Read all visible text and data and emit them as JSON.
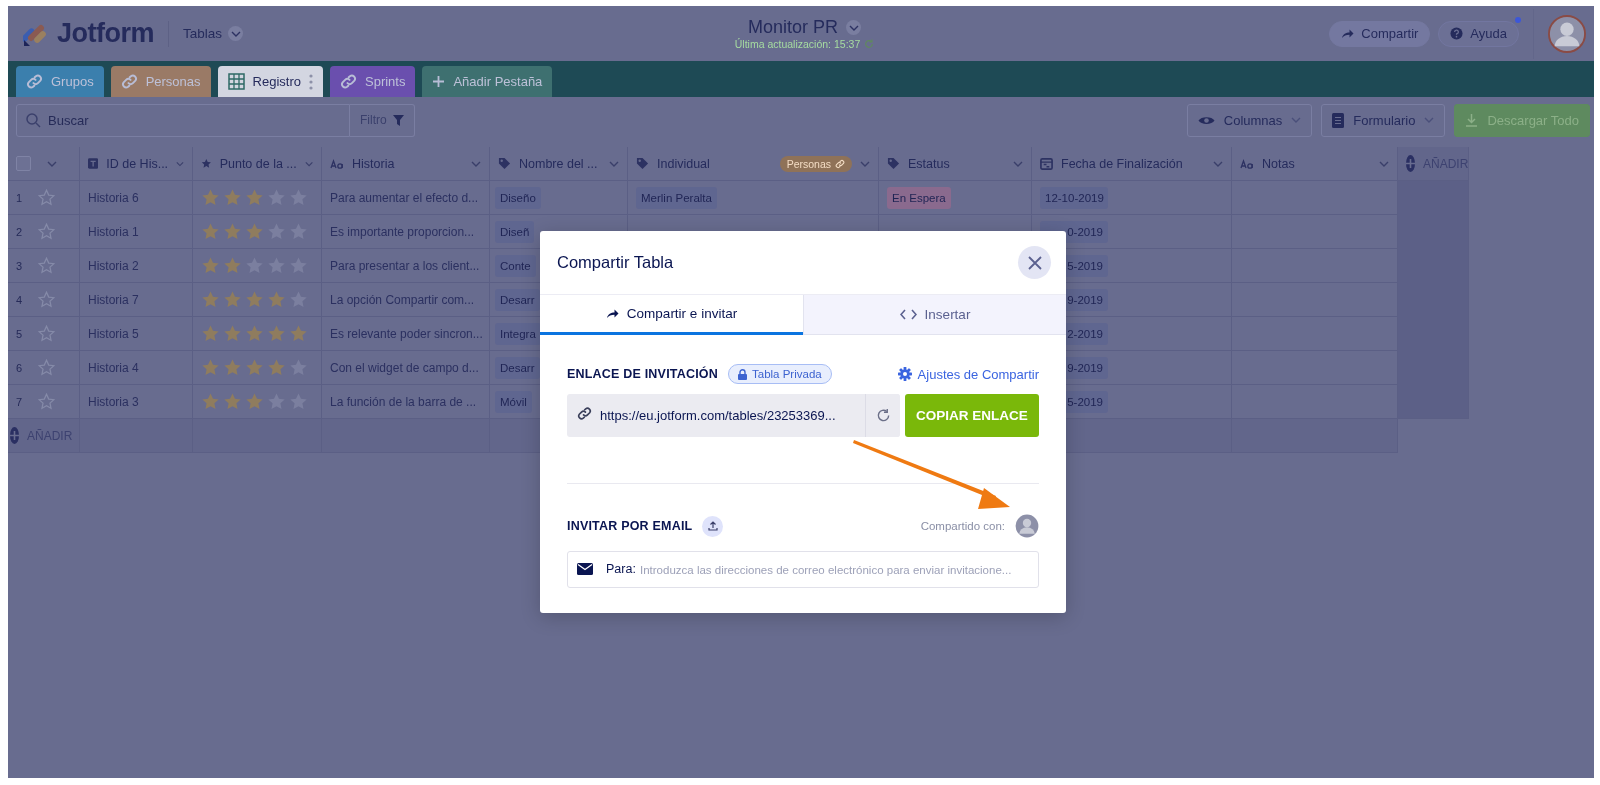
{
  "header": {
    "logo": "Jotform",
    "menu": "Tablas",
    "title": "Monitor PR",
    "subtitle": "Última actualización: 15:37",
    "share_button": "Compartir",
    "help_button": "Ayuda",
    "help_notification": true
  },
  "tabs": [
    {
      "label": "Grupos",
      "kind": "linked",
      "color": "#3b7fad",
      "selected": false
    },
    {
      "label": "Personas",
      "kind": "linked",
      "color": "#9a7a66",
      "selected": false
    },
    {
      "label": "Registro",
      "kind": "table",
      "color": "#d3d6e1",
      "selected": true
    },
    {
      "label": "Sprints",
      "kind": "linked",
      "color": "#6a4fae",
      "selected": false
    },
    {
      "label": "Añadir Pestaña",
      "kind": "add",
      "color": "#3e7070",
      "selected": false
    }
  ],
  "toolbar": {
    "search_placeholder": "Buscar",
    "filter": "Filtro",
    "columns_button": "Columnas",
    "form_button": "Formulario",
    "download_button": "Descargar Todo"
  },
  "table": {
    "select_all_checked": false,
    "columns": [
      {
        "label": "ID de His...",
        "kind": "id"
      },
      {
        "label": "Punto de la ...",
        "kind": "rating"
      },
      {
        "label": "Historia",
        "kind": "text"
      },
      {
        "label": "Nombre del ...",
        "kind": "tag"
      },
      {
        "label": "Individual",
        "kind": "tag",
        "badge": "Personas"
      },
      {
        "label": "Estatus",
        "kind": "tag"
      },
      {
        "label": "Fecha de Finalización",
        "kind": "date"
      },
      {
        "label": "Notas",
        "kind": "text"
      }
    ],
    "add_column": "AÑADIR",
    "rows": [
      {
        "number": "1",
        "favorite": false,
        "id": "Historia 6",
        "stars": 3,
        "story": "Para aumentar el efecto d...",
        "name": "Diseño",
        "individual": "Merlin Peralta",
        "status": {
          "text": "En Espera",
          "color": "#8a6a8e"
        },
        "date": "12-10-2019"
      },
      {
        "number": "2",
        "favorite": false,
        "id": "Historia 1",
        "stars": 3,
        "story": "Es importante proporcion...",
        "name": "Diseñ",
        "date": "0-2019"
      },
      {
        "number": "3",
        "favorite": false,
        "id": "Historia 2",
        "stars": 2,
        "story": "Para presentar a los client...",
        "name": "Conte",
        "date": "5-2019"
      },
      {
        "number": "4",
        "favorite": false,
        "id": "Historia 7",
        "stars": 4,
        "story": "La opción Compartir com...",
        "name": "Desarr",
        "date": "9-2019"
      },
      {
        "number": "5",
        "favorite": false,
        "id": "Historia 5",
        "stars": 5,
        "story": "Es relevante poder sincron...",
        "name": "Integra",
        "date": "2-2019"
      },
      {
        "number": "6",
        "favorite": false,
        "id": "Historia 4",
        "stars": 4,
        "story": "Con el widget de campo d...",
        "name": "Desarr",
        "date": "9-2019"
      },
      {
        "number": "7",
        "favorite": false,
        "id": "Historia 3",
        "stars": 3,
        "story": "La función de la barra de ...",
        "name": "Móvil",
        "date": "5-2019"
      }
    ],
    "add_row": "AÑADIR"
  },
  "modal": {
    "title": "Compartir Tabla",
    "tabs": [
      {
        "label": "Compartir e invitar",
        "kind": "share",
        "selected": true
      },
      {
        "label": "Insertar",
        "kind": "embed",
        "selected": false
      }
    ],
    "invite_label": "ENLACE DE INVITACIÓN",
    "privacy_badge": "Tabla Privada",
    "settings_link": "Ajustes de Compartir",
    "link": "https://eu.jotform.com/tables/23253369...",
    "copy_button": "COPIAR ENLACE",
    "email_label": "INVITAR POR EMAIL",
    "shared_with": "Compartido con:",
    "to_label": "Para:",
    "email_placeholder": "Introduzca las direcciones de correo electrónico para enviar invitacione..."
  }
}
